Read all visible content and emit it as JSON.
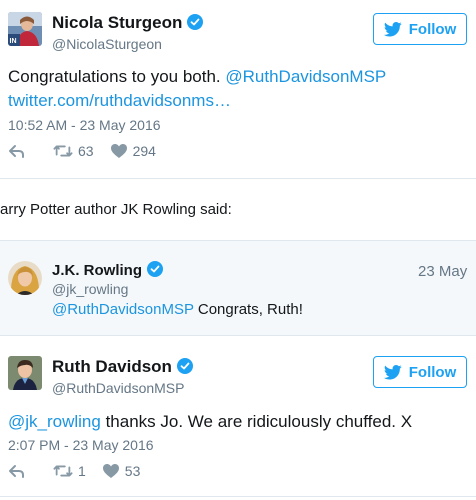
{
  "colors": {
    "accent": "#1da1f2",
    "link": "#1b95e0",
    "muted": "#657786",
    "quote_bg": "#f5f8fa"
  },
  "tweet1": {
    "author_name": "Nicola Sturgeon",
    "handle": "@NicolaSturgeon",
    "follow_label": "Follow",
    "text_plain": "Congratulations to you both. ",
    "text_mention": "@RuthDavidsonMSP",
    "text_link": "twitter.com/ruthdavidsonms…",
    "timestamp": "10:52 AM - 23 May 2016",
    "retweets": "63",
    "likes": "294",
    "avatar_icon": "nicola-sturgeon-avatar"
  },
  "caption": "arry Potter author JK Rowling said:",
  "tweet2": {
    "author_name": "J.K. Rowling",
    "handle": "@jk_rowling",
    "date": "23 May",
    "text_mention": "@RuthDavidsonMSP",
    "text_plain": " Congrats, Ruth!",
    "avatar_icon": "jk-rowling-avatar"
  },
  "tweet3": {
    "author_name": "Ruth Davidson",
    "handle": "@RuthDavidsonMSP",
    "follow_label": "Follow",
    "text_mention": "@jk_rowling",
    "text_plain": " thanks Jo. We are ridiculously chuffed. X",
    "timestamp": "2:07 PM - 23 May 2016",
    "retweets": "1",
    "likes": "53",
    "avatar_icon": "ruth-davidson-avatar"
  }
}
